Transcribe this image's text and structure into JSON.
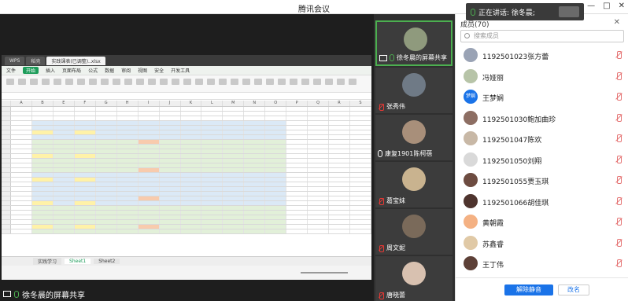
{
  "window": {
    "title": "腾讯会议",
    "minimize": "—",
    "maximize": "□",
    "close": "✕"
  },
  "speaking": {
    "label": "正在讲话: 徐冬晨;"
  },
  "stage": {
    "share_label": "徐冬晨的屏幕共享"
  },
  "excel": {
    "tabs": [
      "WPS",
      "稻壳",
      "实践课表(已调整)..xlsx"
    ],
    "menu": [
      "文件",
      "开始",
      "插入",
      "页面布局",
      "公式",
      "数据",
      "审阅",
      "视图",
      "安全",
      "开发工具"
    ],
    "sheets": [
      "实践学习",
      "Sheet1",
      "Sheet2"
    ],
    "columns": [
      "A",
      "B",
      "E",
      "F",
      "G",
      "H",
      "I",
      "J",
      "K",
      "L",
      "M",
      "N",
      "O",
      "P",
      "Q",
      "R",
      "S"
    ]
  },
  "video_tiles": [
    {
      "name": "徐冬晨的屏幕共享",
      "active": true,
      "muted": false
    },
    {
      "name": "张秀伟",
      "active": false,
      "muted": true
    },
    {
      "name": "康复1901陈柯蓓",
      "active": false,
      "muted": false
    },
    {
      "name": "葛宝妹",
      "active": false,
      "muted": true
    },
    {
      "name": "周文妮",
      "active": false,
      "muted": true
    },
    {
      "name": "唐晓蕾",
      "active": false,
      "muted": true
    }
  ],
  "panel": {
    "title": "成员(70)",
    "close": "✕",
    "search_placeholder": "搜索成员",
    "members": [
      {
        "name": "1192501023张方蕾",
        "color": "#9aa3b5"
      },
      {
        "name": "冯娅丽",
        "color": "#b7c4a8"
      },
      {
        "name": "王梦娴",
        "color": "#1a73e8",
        "initials": "梦娴"
      },
      {
        "name": "1192501030鲍加曲珍",
        "color": "#8d6e63"
      },
      {
        "name": "1192501047陈欢",
        "color": "#c8b8a6"
      },
      {
        "name": "1192501050刘翔",
        "color": "#d9d9d9"
      },
      {
        "name": "1192501055贾玉琪",
        "color": "#6d4c41"
      },
      {
        "name": "1192501066胡佳琪",
        "color": "#4e342e"
      },
      {
        "name": "黄朝霞",
        "color": "#f4b183"
      },
      {
        "name": "苏鑫睿",
        "color": "#e0c9a6"
      },
      {
        "name": "王丁伟",
        "color": "#5d4037"
      }
    ],
    "unmute_button": "解除静音",
    "rename_button": "改名"
  }
}
